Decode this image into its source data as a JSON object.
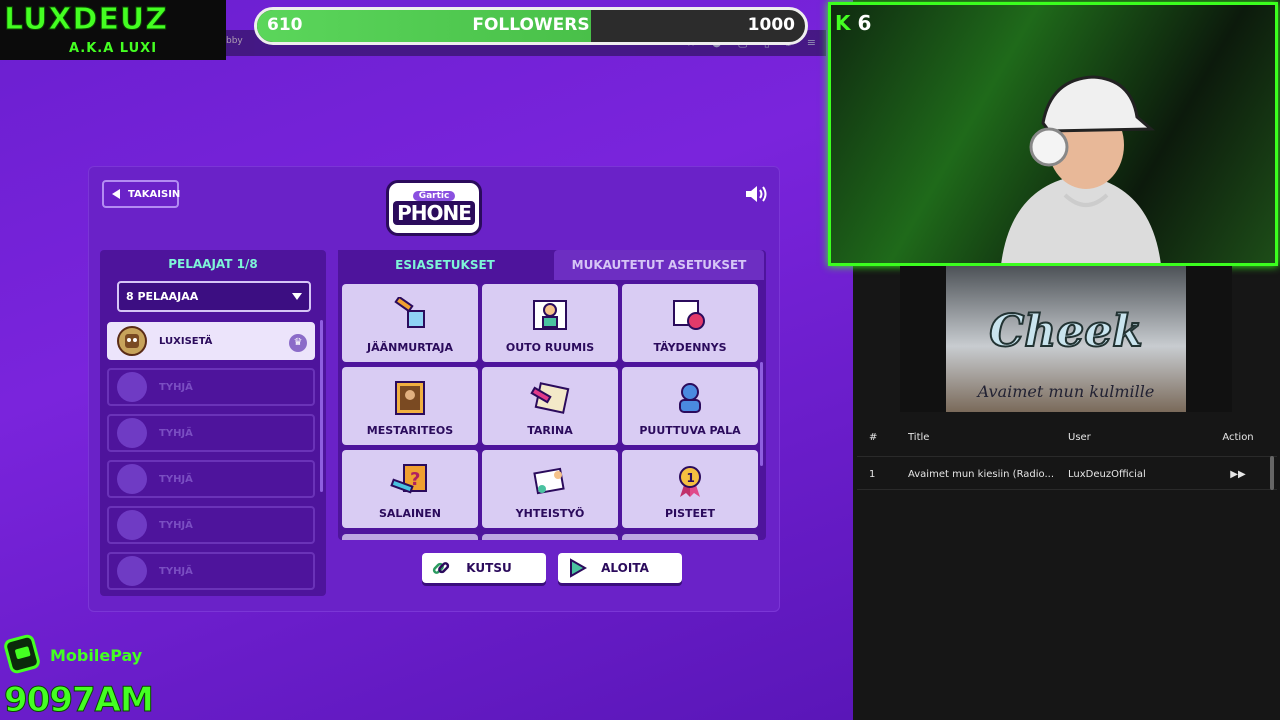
{
  "overlay": {
    "channel_name": "LUXDEUZ",
    "channel_aka": "A.K.A LUXI",
    "followers": {
      "current": "610",
      "label": "FOLLOWERS",
      "goal": "1000",
      "progress": 0.61
    },
    "mobilepay": {
      "label": "MobilePay",
      "code": "9097AM"
    },
    "cam_counter": {
      "letter": "K",
      "value": "6"
    }
  },
  "browser": {
    "tab_fragment": "bby"
  },
  "game": {
    "back_label": "TAKAISIN",
    "logo": {
      "top": "Gartic",
      "bottom": "PHONE"
    },
    "players": {
      "title": "PELAAJAT 1/8",
      "select_value": "8 PELAAJAA",
      "list": [
        {
          "name": "LUXISETÄ",
          "host": true
        },
        {
          "name": "TYHJÄ"
        },
        {
          "name": "TYHJÄ"
        },
        {
          "name": "TYHJÄ"
        },
        {
          "name": "TYHJÄ"
        },
        {
          "name": "TYHJÄ"
        }
      ]
    },
    "tabs": {
      "presets": "ESIASETUKSET",
      "custom": "MUKAUTETUT ASETUKSET"
    },
    "modes": [
      {
        "label": "JÄÄNMURTAJA",
        "icon": "icebreaker-icon"
      },
      {
        "label": "OUTO RUUMIS",
        "icon": "weird-body-icon"
      },
      {
        "label": "TÄYDENNYS",
        "icon": "complement-icon"
      },
      {
        "label": "MESTARITEOS",
        "icon": "masterpiece-icon"
      },
      {
        "label": "TARINA",
        "icon": "story-icon"
      },
      {
        "label": "PUUTTUVA PALA",
        "icon": "missing-piece-icon"
      },
      {
        "label": "SALAINEN",
        "icon": "secret-icon"
      },
      {
        "label": "YHTEISTYÖ",
        "icon": "cooperation-icon"
      },
      {
        "label": "PISTEET",
        "icon": "score-icon"
      }
    ],
    "invite_label": "KUTSU",
    "start_label": "ALOITA"
  },
  "album": {
    "artist": "Cheek",
    "title": "Avaimet mun kulmille"
  },
  "queue": {
    "headers": {
      "num": "#",
      "title": "Title",
      "user": "User",
      "action": "Action"
    },
    "rows": [
      {
        "num": "1",
        "title": "Avaimet mun kiesiin (Radio...",
        "user": "LuxDeuzOfficial"
      }
    ]
  },
  "colors": {
    "accent_green": "#44ff22",
    "teal": "#7ef5d8",
    "purple": "#6a22c8"
  }
}
